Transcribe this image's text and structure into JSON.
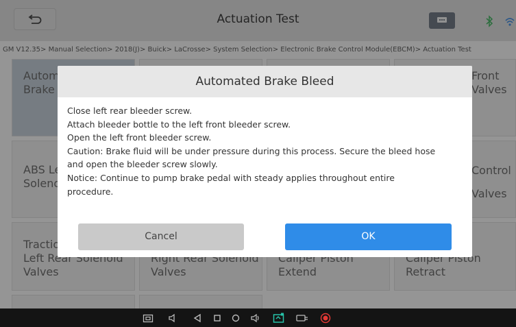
{
  "header": {
    "title": "Actuation Test",
    "breadcrumb": "GM V12.35> Manual Selection> 2018(J)> Buick> LaCrosse> System Selection> Electronic Brake Control Module(EBCM)> Actuation Test"
  },
  "tiles": [
    {
      "line1": "Automated",
      "line2": "Brake Bleed",
      "selected": true
    },
    {
      "line1": "",
      "line2": ""
    },
    {
      "line1": "",
      "line2": ""
    },
    {
      "line1": "Front",
      "line2": "Valves"
    },
    {
      "line1": "ABS Left",
      "line2": "Solenoid"
    },
    {
      "line1": "",
      "line2": ""
    },
    {
      "line1": "",
      "line2": ""
    },
    {
      "line1": "Control",
      "line2": "Valves"
    },
    {
      "line1": "Traction",
      "line2": "Left Rear Solenoid Valves"
    },
    {
      "line1": "",
      "line2": "Right Rear Solenoid Valves"
    },
    {
      "line1": "",
      "line2": "Caliper Piston Extend"
    },
    {
      "line1": "",
      "line2": "Caliper Piston Retract"
    }
  ],
  "dialog": {
    "title": "Automated Brake Bleed",
    "lines": [
      "Close left rear bleeder screw.",
      "Attach bleeder bottle to the left front bleeder screw.",
      "Open the left front bleeder screw.",
      "Caution: Brake fluid will be under pressure during this process. Secure the bleed hose",
      "and open the bleeder screw slowly.",
      "Notice: Continue to pump brake pedal with steady applies throughout entire",
      "procedure."
    ],
    "cancel_label": "Cancel",
    "ok_label": "OK"
  },
  "colors": {
    "ok_button": "#2f8ce8",
    "cancel_button": "#c9c9c9",
    "header_bg": "#d3d3d3",
    "selected_tile": "#b6c2cd",
    "record_icon": "#e53935"
  },
  "icons": {
    "back": "back-arrow-icon",
    "message": "message-icon",
    "bluetooth": "bluetooth-icon",
    "wifi": "wifi-icon",
    "nav": [
      "screenshot-icon",
      "volume-down-icon",
      "back-triangle-icon",
      "recent-apps-icon",
      "home-icon",
      "volume-up-icon",
      "diagnostic-icon",
      "vci-icon",
      "record-icon"
    ]
  }
}
